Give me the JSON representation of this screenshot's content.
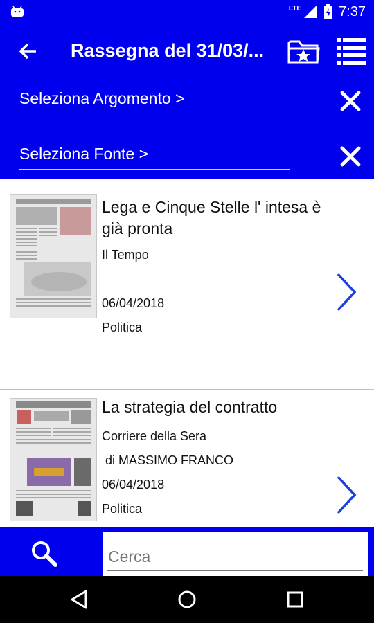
{
  "status_bar": {
    "app_icon": "android-icon",
    "network": "LTE",
    "time": "7:37"
  },
  "app_bar": {
    "title": "Rassegna del 31/03/...",
    "back_icon": "arrow-left-icon",
    "favorites_icon": "folder-star-icon",
    "menu_icon": "list-icon"
  },
  "filters": [
    {
      "label": "Seleziona Argomento >",
      "clear_icon": "close-icon"
    },
    {
      "label": "Seleziona Fonte >",
      "clear_icon": "close-icon"
    }
  ],
  "articles": [
    {
      "headline": "Lega e Cinque Stelle l' intesa è già pronta",
      "source": "Il Tempo",
      "author": "",
      "date": "06/04/2018",
      "category": "Politica"
    },
    {
      "headline": "La strategia del contratto",
      "source": "Corriere della Sera",
      "author": " di MASSIMO FRANCO",
      "date": "06/04/2018",
      "category": "Politica"
    }
  ],
  "search": {
    "placeholder": "Cerca",
    "icon": "search-icon"
  },
  "nav": {
    "back": "back-icon",
    "home": "home-icon",
    "recents": "recents-icon"
  },
  "colors": {
    "primary": "#0000ee",
    "chevron": "#1a3ee0"
  }
}
